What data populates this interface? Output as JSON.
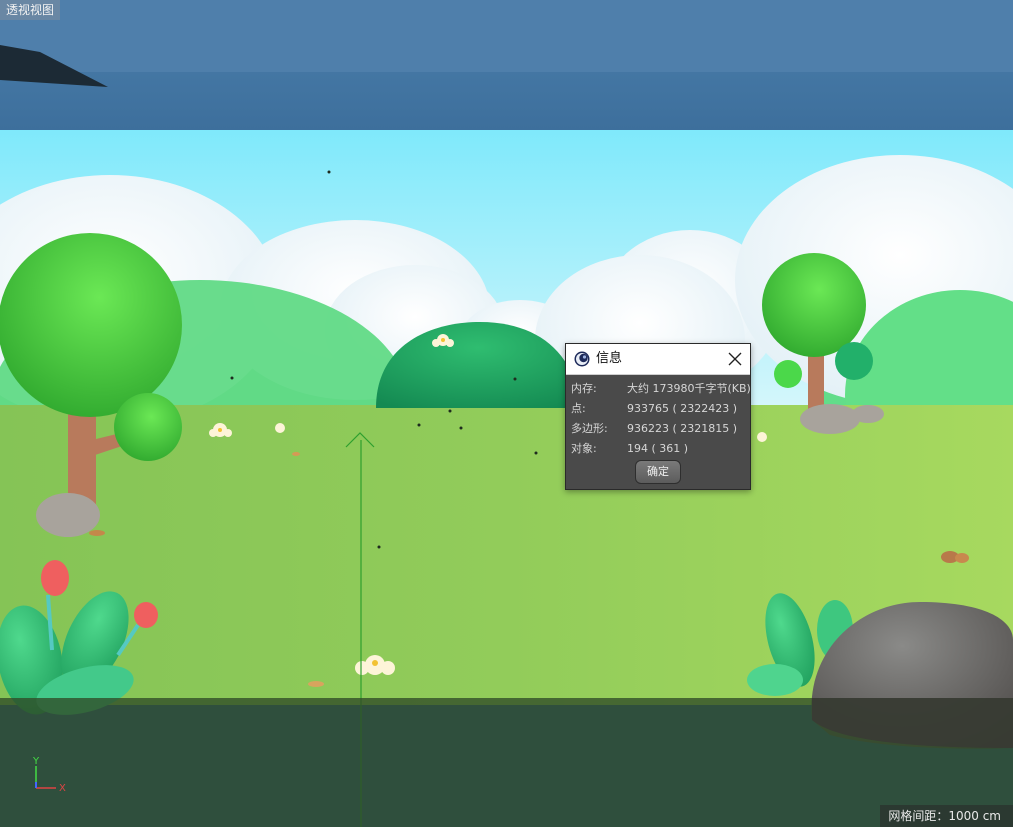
{
  "viewport": {
    "label": "透视视图",
    "grid_spacing": "网格间距：1000 cm"
  },
  "axis": {
    "y_label": "Y",
    "x_label": "X"
  },
  "info_dialog": {
    "title": "信息",
    "rows": [
      {
        "label": "内存:",
        "value": "大约 173980千字节(KB)"
      },
      {
        "label": "点:",
        "value": "933765 ( 2322423 )"
      },
      {
        "label": "多边形:",
        "value": "936223 ( 2321815 )"
      },
      {
        "label": "对象:",
        "value": "194 ( 361 )"
      }
    ],
    "ok_label": "确定"
  },
  "colors": {
    "sky_top": "#2d5f8f",
    "sky_light": "#7fe3f5",
    "grass": "#8dc95a",
    "tree_green": "#3dc43a",
    "hill_dark": "#1fa865"
  },
  "icons": [
    "cinema4d-app-icon",
    "close-icon"
  ]
}
